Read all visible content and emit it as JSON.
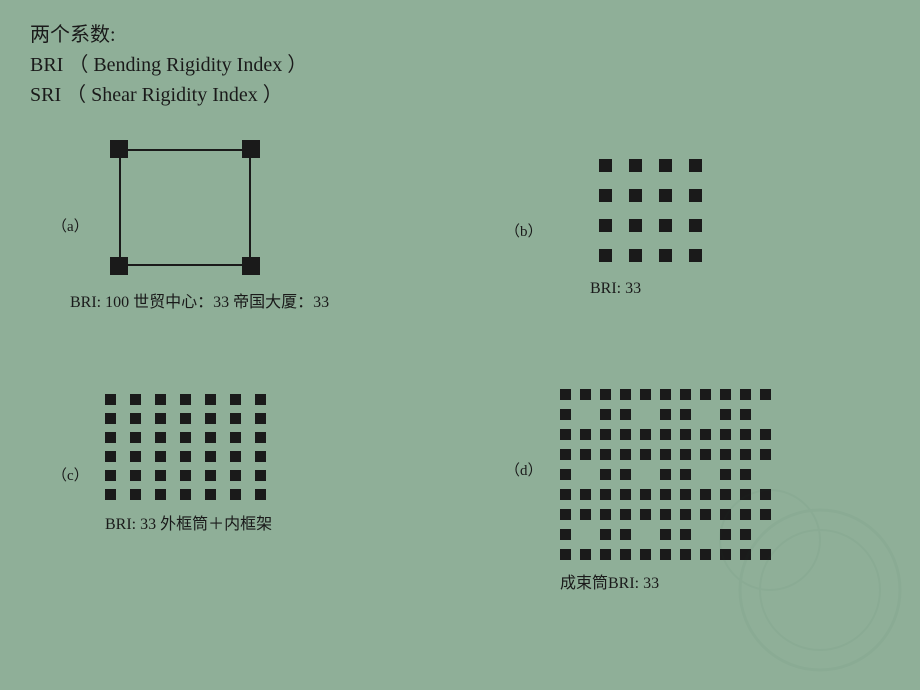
{
  "header": {
    "line1": "两个系数:",
    "line2": "BRI  （ Bending Rigidity Index ）",
    "line3": "SRI  （ Shear Rigidity Index  ）"
  },
  "quadrant_a": {
    "label": "（a）",
    "bri_text": "BRI: 100        世贸中心：33   帝国大厦：33"
  },
  "quadrant_b": {
    "label": "（b）",
    "bri_text": "BRI: 33"
  },
  "quadrant_c": {
    "label": "（c）",
    "bri_text": "BRI: 33  外框筒＋内框架"
  },
  "quadrant_d": {
    "label": "（d）",
    "bri_text": "成束筒BRI: 33"
  }
}
